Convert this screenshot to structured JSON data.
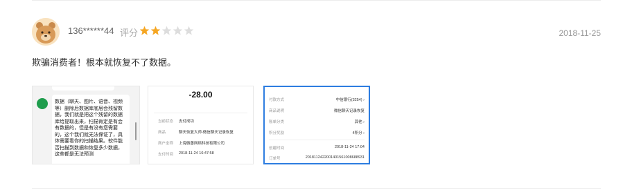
{
  "review": {
    "username": "136******44",
    "score_label": "评分",
    "rating": 2,
    "max_rating": 5,
    "star_color_filled": "#f5a623",
    "star_color_empty": "#dddddd",
    "date": "2018-11-25",
    "text": "欺骗消费者！根本就恢复不了数据。"
  },
  "thumbnails": {
    "chat": {
      "text": "数据（聊天、图片、语音、视频等）删除后数据库底层会残留数据，我们就是把这个残留的数据库给提取出来，扫描肯定是有会有数据的，但是有没有您需要的，这个我们就无法保证了，具体需要看你的扫描结果。软件能否扫描到数据和恢复多少数据，这些都是无法预测"
    },
    "payment": {
      "amount": "-28.00",
      "rows": [
        {
          "label": "当前状态",
          "value": "支付成功"
        },
        {
          "label": "商品",
          "value": "聊天恢复大师-微信聊天记录恢复"
        },
        {
          "label": "商户全称",
          "value": "上海微善网络科技有限公司"
        },
        {
          "label": "支付时间",
          "value": "2018-11-24 16:47:58"
        }
      ]
    },
    "order": {
      "rows": [
        {
          "label": "付款方式",
          "value": "中信银行(3254) ›"
        },
        {
          "label": "商品说明",
          "value": "微信聊天记录恢复"
        },
        {
          "label": "账单分类",
          "value": "其他 ›"
        },
        {
          "label": "积分奖励",
          "value": "4积分 ›"
        },
        {
          "label": "创建时间",
          "value": "2018-11-24 17:04"
        },
        {
          "label": "订单号",
          "value": "2018112422001401561008688931"
        }
      ]
    }
  }
}
